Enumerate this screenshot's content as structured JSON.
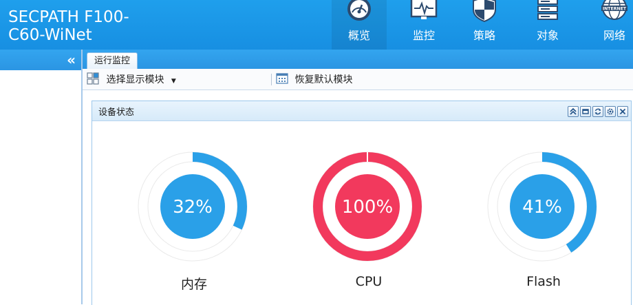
{
  "app": {
    "title_line1": "SECPATH F100-",
    "title_line2": "C60-WiNet"
  },
  "nav": [
    {
      "label": "概览",
      "icon": "dashboard-icon",
      "active": true
    },
    {
      "label": "监控",
      "icon": "monitor-icon",
      "active": false
    },
    {
      "label": "策略",
      "icon": "shield-icon",
      "active": false
    },
    {
      "label": "对象",
      "icon": "server-icon",
      "active": false
    },
    {
      "label": "网络",
      "icon": "internet-globe-icon",
      "active": false,
      "icon_text": "INTERNET"
    }
  ],
  "sidebar": {
    "collapse_label": "«"
  },
  "tabs": [
    {
      "label": "运行监控"
    }
  ],
  "toolbar": {
    "select_modules": "选择显示模块",
    "restore_default": "恢复默认模块"
  },
  "panel": {
    "title": "设备状态"
  },
  "gauges": [
    {
      "name": "内存",
      "percent": 32,
      "display": "32%",
      "color": "#2aa0e8"
    },
    {
      "name": "CPU",
      "percent": 100,
      "display": "100%",
      "color": "#f2395d"
    },
    {
      "name": "Flash",
      "percent": 41,
      "display": "41%",
      "color": "#2aa0e8"
    }
  ]
}
